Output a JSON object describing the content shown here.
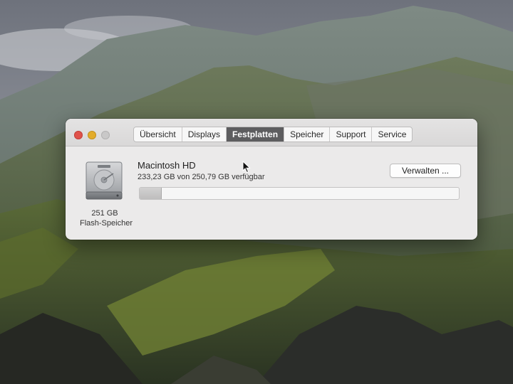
{
  "window": {
    "tabs": [
      {
        "label": "Übersicht",
        "selected": false
      },
      {
        "label": "Displays",
        "selected": false
      },
      {
        "label": "Festplatten",
        "selected": true
      },
      {
        "label": "Speicher",
        "selected": false
      },
      {
        "label": "Support",
        "selected": false
      },
      {
        "label": "Service",
        "selected": false
      }
    ],
    "disk": {
      "name": "Macintosh HD",
      "available_text": "233,23 GB von 250,79 GB verfügbar",
      "capacity": "251 GB",
      "type": "Flash-Speicher",
      "used_fraction": 0.07,
      "icon": "hard-drive-icon"
    },
    "manage_button": "Verwalten ..."
  },
  "colors": {
    "close": "#e0524b",
    "minimize": "#e3ac2a",
    "zoom_disabled": "#c9c8c8",
    "selected_tab": "#5d5d5f"
  }
}
